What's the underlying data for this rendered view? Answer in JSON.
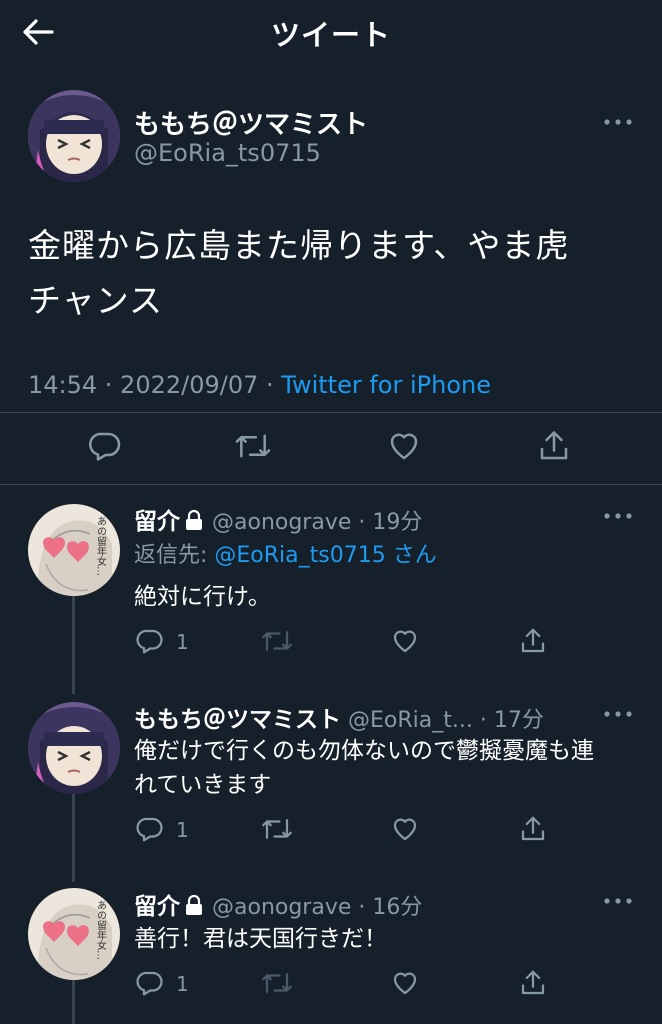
{
  "header": {
    "title": "ツイート"
  },
  "main": {
    "name": "ももち＠ツマミスト",
    "handle": "@EoRia_ts0715",
    "text_line1": "金曜から広島また帰ります、やま虎",
    "text_line2": "チャンス",
    "time": "14:54 · 2022/09/07 · ",
    "source": "Twitter for iPhone"
  },
  "replies": [
    {
      "name": "留介",
      "handle": "@aonograve",
      "time": "19分",
      "reply_to_prefix": "返信先: ",
      "reply_to_handle": "@EoRia_ts0715",
      "reply_to_suffix": " さん",
      "text": "絶対に行け。",
      "reply_count": "1"
    },
    {
      "name": "ももち＠ツマミスト",
      "handle": "@EoRia_t...",
      "time": "17分",
      "text_line1": "俺だけで行くのも勿体ないので鬱擬憂魔も連",
      "text_line2": "れていきます",
      "reply_count": "1"
    },
    {
      "name": "留介",
      "handle": "@aonograve",
      "time": "16分",
      "text": "善行！君は天国行きだ！",
      "reply_count": "1"
    }
  ],
  "icons": [
    "back-arrow-icon",
    "more-icon",
    "reply-icon",
    "retweet-icon",
    "like-icon",
    "share-icon",
    "lock-icon"
  ],
  "colors": {
    "background": "#15202b",
    "text": "#ffffff",
    "secondary": "#8899a6",
    "link": "#1d9bf0",
    "divider": "#38444d"
  }
}
